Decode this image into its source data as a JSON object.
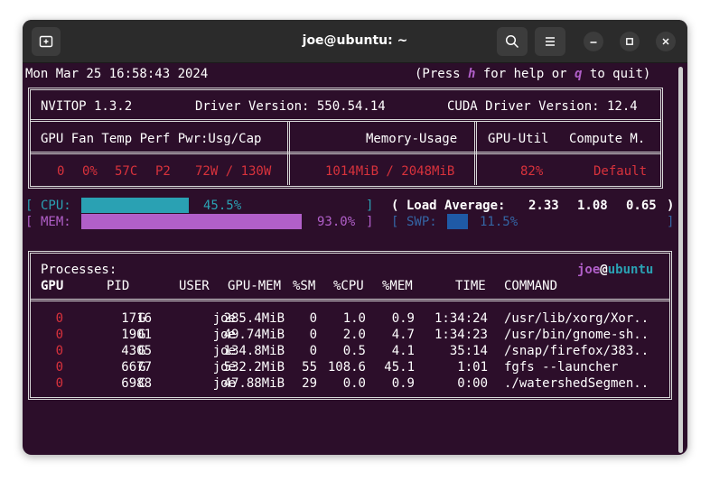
{
  "window": {
    "title": "joe@ubuntu: ~"
  },
  "header": {
    "datetime": "Mon Mar 25 16:58:43 2024",
    "help_open": "(Press ",
    "help_key": "h",
    "help_mid": " for help or ",
    "quit_key": "q",
    "help_close": " to quit)"
  },
  "gpu_info": {
    "app": "NVITOP 1.3.2",
    "driver": "Driver Version: 550.54.14",
    "cuda": "CUDA Driver Version: 12.4",
    "col_left": "GPU Fan Temp Perf Pwr:Usg/Cap",
    "col_mem": "Memory-Usage",
    "col_util": "GPU-Util",
    "col_compute": "Compute M.",
    "row": {
      "gpu": "0",
      "fan": "0%",
      "temp": "57C",
      "perf": "P2",
      "power": "72W / 130W",
      "memory": "1014MiB / 2048MiB",
      "util": "82%",
      "compute": "Default"
    }
  },
  "system": {
    "cpu_label": "CPU:",
    "cpu_pct_text": "45.5%",
    "cpu_fraction": 0.455,
    "mem_label": "MEM:",
    "mem_pct_text": "93.0%",
    "mem_fraction": 0.93,
    "swp_label": "SWP:",
    "swp_pct_text": "11.5%",
    "swp_fraction": 0.115,
    "load_label": "( Load Average:",
    "load_1": "2.33",
    "load_5": "1.08",
    "load_15": "0.65",
    "load_close": ")"
  },
  "processes": {
    "title": "Processes:",
    "user": "joe",
    "at": "@",
    "host": "ubuntu",
    "columns": [
      "GPU",
      "PID",
      "USER",
      "GPU-MEM",
      "%SM",
      "%CPU",
      "%MEM",
      "TIME",
      "COMMAND"
    ],
    "rows": [
      {
        "gpu": "0",
        "pid": "1716",
        "type": "G",
        "user": "joe",
        "gpu_mem": "285.4MiB",
        "sm": "0",
        "cpu": "1.0",
        "mem": "0.9",
        "time": "1:34:24",
        "command": "/usr/lib/xorg/Xor.."
      },
      {
        "gpu": "0",
        "pid": "1901",
        "type": "G",
        "user": "joe",
        "gpu_mem": "49.74MiB",
        "sm": "0",
        "cpu": "2.0",
        "mem": "4.7",
        "time": "1:34:23",
        "command": "/usr/bin/gnome-sh.."
      },
      {
        "gpu": "0",
        "pid": "4305",
        "type": "G",
        "user": "joe",
        "gpu_mem": "134.8MiB",
        "sm": "0",
        "cpu": "0.5",
        "mem": "4.1",
        "time": "35:14",
        "command": "/snap/firefox/383.."
      },
      {
        "gpu": "0",
        "pid": "6677",
        "type": "G",
        "user": "joe",
        "gpu_mem": "532.2MiB",
        "sm": "55",
        "cpu": "108.6",
        "mem": "45.1",
        "time": "1:01",
        "command": "fgfs --launcher"
      },
      {
        "gpu": "0",
        "pid": "6988",
        "type": "C",
        "user": "joe",
        "gpu_mem": "47.88MiB",
        "sm": "29",
        "cpu": "0.0",
        "mem": "0.9",
        "time": "0:00",
        "command": "./watershedSegmen.."
      }
    ]
  },
  "colors": {
    "terminal_bg": "#2c0e2a",
    "cpu_bar": "#2aa1b3",
    "mem_bar": "#b15fc9",
    "swp_bar": "#1f5aa6",
    "gpu_row": "#d8323c"
  },
  "icons": [
    "new-tab-icon",
    "search-icon",
    "hamburger-menu-icon",
    "minimize-icon",
    "maximize-icon",
    "close-icon"
  ]
}
